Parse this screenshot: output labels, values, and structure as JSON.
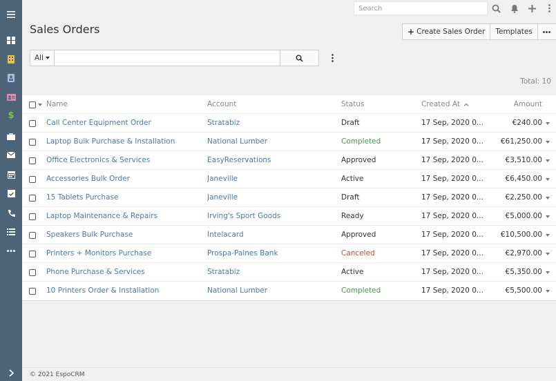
{
  "app": {
    "footer": "© 2021 EspoCRM"
  },
  "colors": {
    "sidebar_bg": "#4d6478",
    "link": "#4a7aa8",
    "completed": "#4a9a4a",
    "canceled": "#c0503a"
  },
  "topbar": {
    "search_placeholder": "Search"
  },
  "sidebar": {
    "items": [
      {
        "icon": "menu-icon"
      },
      {
        "icon": "dashboard-icon"
      },
      {
        "icon": "building-icon"
      },
      {
        "icon": "contact-book-icon"
      },
      {
        "icon": "id-card-icon"
      },
      {
        "icon": "dollar-icon"
      },
      {
        "icon": "briefcase-icon"
      },
      {
        "icon": "envelope-icon"
      },
      {
        "icon": "calendar-icon"
      },
      {
        "icon": "calendar-check-icon"
      },
      {
        "icon": "phone-icon"
      },
      {
        "icon": "task-list-icon"
      },
      {
        "icon": "more-icon"
      },
      {
        "icon": "expand-icon"
      }
    ]
  },
  "header": {
    "title": "Sales Orders",
    "create_label": "Create Sales Order",
    "templates_label": "Templates"
  },
  "filter": {
    "scope_label": "All",
    "query": ""
  },
  "list": {
    "total_label": "Total: 10",
    "columns": {
      "name": "Name",
      "account": "Account",
      "status": "Status",
      "created_at": "Created At",
      "amount": "Amount"
    },
    "rows": [
      {
        "name": "Call Center Equipment Order",
        "account": "Stratabiz",
        "status": "Draft",
        "created": "17 Sep, 2020 0...",
        "amount": "€240.00"
      },
      {
        "name": "Laptop Bulk Purchase & Installation",
        "account": "National Lumber",
        "status": "Completed",
        "created": "17 Sep, 2020 0...",
        "amount": "€61,250.00"
      },
      {
        "name": "Office Electronics & Services",
        "account": "EasyReservations",
        "status": "Approved",
        "created": "17 Sep, 2020 0...",
        "amount": "€3,510.00"
      },
      {
        "name": "Accessories Bulk Order",
        "account": "Janeville",
        "status": "Active",
        "created": "17 Sep, 2020 0...",
        "amount": "€6,450.00"
      },
      {
        "name": "15 Tablets Purchase",
        "account": "Janeville",
        "status": "Draft",
        "created": "17 Sep, 2020 0...",
        "amount": "€2,250.00"
      },
      {
        "name": "Laptop Maintenance & Repairs",
        "account": "Irving's Sport Goods",
        "status": "Ready",
        "created": "17 Sep, 2020 0...",
        "amount": "€5,000.00"
      },
      {
        "name": "Speakers Bulk Purchase",
        "account": "Intelacard",
        "status": "Approved",
        "created": "17 Sep, 2020 0...",
        "amount": "€10,500.00"
      },
      {
        "name": "Printers + Monitors Purchase",
        "account": "Prospa-Palnes Bank",
        "status": "Canceled",
        "created": "17 Sep, 2020 0...",
        "amount": "€2,970.00"
      },
      {
        "name": "Phone Purchase & Services",
        "account": "Stratabiz",
        "status": "Active",
        "created": "17 Sep, 2020 0...",
        "amount": "€5,350.00"
      },
      {
        "name": "10 Printers Order & Installation",
        "account": "National Lumber",
        "status": "Completed",
        "created": "17 Sep, 2020 0...",
        "amount": "€5,500.00"
      }
    ]
  }
}
